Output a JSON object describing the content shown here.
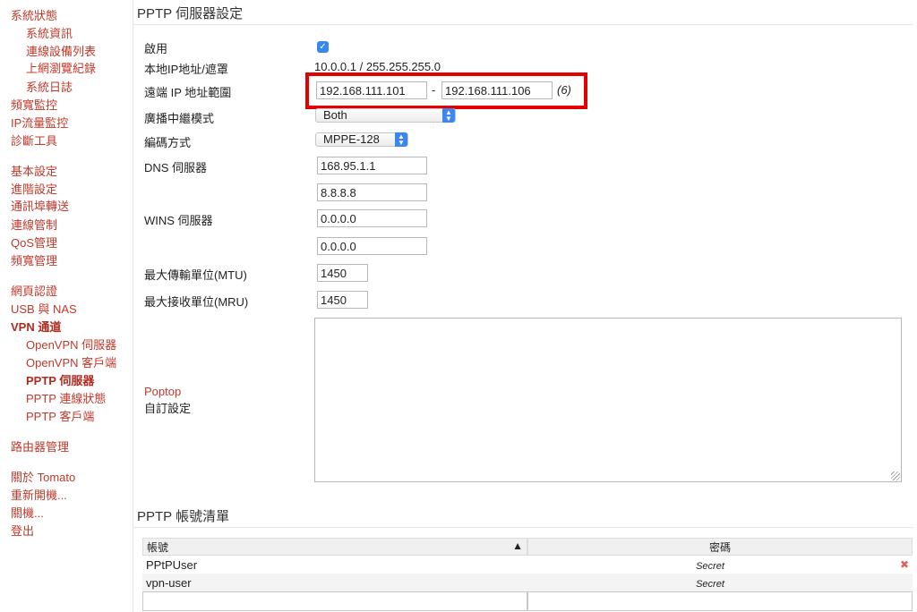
{
  "sidebar": {
    "items": [
      {
        "label": "系統狀態",
        "level": 0
      },
      {
        "label": "系統資訊",
        "level": 1
      },
      {
        "label": "連線設備列表",
        "level": 1
      },
      {
        "label": "上網瀏覽紀錄",
        "level": 1
      },
      {
        "label": "系統日誌",
        "level": 1
      },
      {
        "label": "頻寬監控",
        "level": 0
      },
      {
        "label": "IP流量監控",
        "level": 0
      },
      {
        "label": "診斷工具",
        "level": 0
      },
      {
        "label": "基本設定",
        "level": 0
      },
      {
        "label": "進階設定",
        "level": 0
      },
      {
        "label": "通訊埠轉送",
        "level": 0
      },
      {
        "label": "連線管制",
        "level": 0
      },
      {
        "label": "QoS管理",
        "level": 0
      },
      {
        "label": "頻寬管理",
        "level": 0
      },
      {
        "label": "網頁認證",
        "level": 0
      },
      {
        "label": "USB 與 NAS",
        "level": 0
      },
      {
        "label": "VPN 通道",
        "level": 0,
        "active": true
      },
      {
        "label": "OpenVPN 伺服器",
        "level": 1
      },
      {
        "label": "OpenVPN 客戶端",
        "level": 1
      },
      {
        "label": "PPTP 伺服器",
        "level": 1,
        "active": true
      },
      {
        "label": "PPTP 連線狀態",
        "level": 1
      },
      {
        "label": "PPTP 客戶端",
        "level": 1
      },
      {
        "label": "路由器管理",
        "level": 0
      },
      {
        "label": "關於 Tomato",
        "level": 0
      },
      {
        "label": "重新開機...",
        "level": 0
      },
      {
        "label": "關機...",
        "level": 0
      },
      {
        "label": "登出",
        "level": 0
      }
    ]
  },
  "server": {
    "title": "PPTP 伺服器設定",
    "enable_label": "啟用",
    "enabled": true,
    "local_ip_label": "本地IP地址/遮罩",
    "local_ip_value": "10.0.0.1 / 255.255.255.0",
    "remote_range_label": "遠端 IP 地址範圍",
    "remote_start": "192.168.111.101",
    "range_dash": "-",
    "remote_end": "192.168.111.106",
    "range_count": "(6)",
    "broadcast_label": "廣播中繼模式",
    "broadcast_value": "Both",
    "encryption_label": "編碼方式",
    "encryption_value": "MPPE-128",
    "dns_label": "DNS 伺服器",
    "dns1": "168.95.1.1",
    "dns2": "8.8.8.8",
    "wins_label": "WINS 伺服器",
    "wins1": "0.0.0.0",
    "wins2": "0.0.0.0",
    "mtu_label": "最大傳輸單位(MTU)",
    "mtu_value": "1450",
    "mru_label": "最大接收單位(MRU)",
    "mru_value": "1450",
    "custom_link": "Poptop",
    "custom_label": "自訂設定",
    "custom_value": ""
  },
  "accounts": {
    "title": "PPTP 帳號清單",
    "col_user": "帳號",
    "col_pass": "密碼",
    "sort_indicator": "▲",
    "rows": [
      {
        "user": "PPtPUser",
        "password": "Secret"
      },
      {
        "user": "vpn-user",
        "password": "Secret"
      }
    ],
    "delete_glyph": "✖"
  },
  "colors": {
    "nav_link": "#c0392b",
    "highlight_box": "#e30000",
    "select_accent": "#3a87f0"
  },
  "icons": {
    "checkbox": "check-icon",
    "select": "select-arrows-icon",
    "sort": "sort-ascending-icon",
    "delete": "delete-x-icon"
  }
}
